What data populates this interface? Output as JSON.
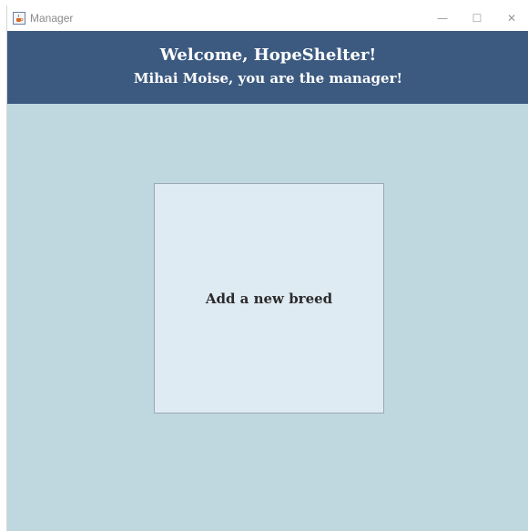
{
  "window": {
    "title": "Manager",
    "app_icon": "java-cup-icon",
    "controls": {
      "minimize": "—",
      "maximize": "☐",
      "close": "✕"
    }
  },
  "header": {
    "welcome": "Welcome, HopeShelter!",
    "subtitle": "Mihai Moise, you are the manager!"
  },
  "main": {
    "add_breed_label": "Add a new breed"
  },
  "colors": {
    "header_bg": "#3c5a80",
    "content_bg": "#bfd7de",
    "card_bg": "#dfebf3"
  }
}
